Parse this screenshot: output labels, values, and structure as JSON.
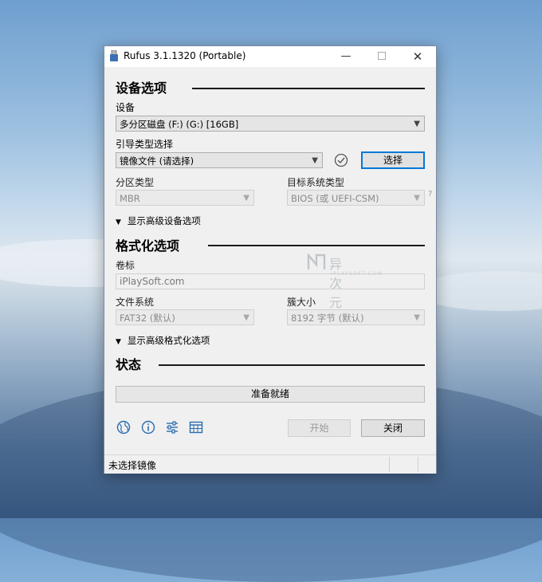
{
  "window": {
    "title": "Rufus 3.1.1320 (Portable)",
    "controls": {
      "minimize": "—",
      "maximize": "☐",
      "close": "✕"
    }
  },
  "device_section": {
    "heading": "设备选项",
    "device_label": "设备",
    "device_value": "多分区磁盘 (F:) (G:) [16GB]",
    "boot_label": "引导类型选择",
    "boot_value": "镜像文件 (请选择)",
    "select_button": "选择",
    "partition_label": "分区类型",
    "partition_value": "MBR",
    "target_label": "目标系统类型",
    "target_value": "BIOS (或 UEFI-CSM)",
    "help_mark": "?",
    "advanced_toggle": "显示高级设备选项"
  },
  "format_section": {
    "heading": "格式化选项",
    "volume_label": "卷标",
    "volume_value": "iPlaySoft.com",
    "fs_label": "文件系统",
    "fs_value": "FAT32 (默认)",
    "cluster_label": "簇大小",
    "cluster_value": "8192 字节 (默认)",
    "advanced_toggle": "显示高级格式化选项"
  },
  "status_section": {
    "heading": "状态",
    "progress_text": "准备就绪",
    "progress_value": 0
  },
  "toolbar": {
    "icons": [
      "globe-icon",
      "info-icon",
      "settings-sliders-icon",
      "log-table-icon"
    ],
    "start_button": "开始",
    "close_button": "关闭"
  },
  "statusbar": {
    "text": "未选择镜像"
  },
  "watermark": {
    "brand": "异次元",
    "sub": "IPLAYSOFT.COM"
  },
  "colors": {
    "accent": "#0078d7",
    "icon_blue": "#2b6cb0"
  }
}
